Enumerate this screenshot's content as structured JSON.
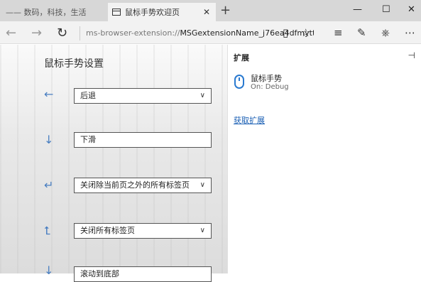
{
  "tabs": [
    {
      "label": "—— 数码，科技，生活",
      "active": false
    },
    {
      "label": "鼠标手势欢迎页",
      "active": true
    }
  ],
  "address": {
    "scheme": "ms-browser-extension://",
    "rest": "MSGextensionName_j76ea4dfmytt"
  },
  "page": {
    "title": "鼠标手势设置",
    "gestures": [
      {
        "arrow": "←",
        "action": "后退"
      },
      {
        "arrow": "↓",
        "action": "下滑"
      },
      {
        "arrow": "↵",
        "action": "关闭除当前页之外的所有标签页"
      },
      {
        "arrow": "⮤",
        "action": "关闭所有标签页"
      },
      {
        "arrow": "↓",
        "action": "滚动到底部"
      }
    ]
  },
  "panel": {
    "title": "扩展",
    "extension": {
      "name": "鼠标手势",
      "status": "On: Debug"
    },
    "get_link": "获取扩展"
  },
  "colors": {
    "accent": "#4a7fc1",
    "link": "#1a5fb4"
  }
}
